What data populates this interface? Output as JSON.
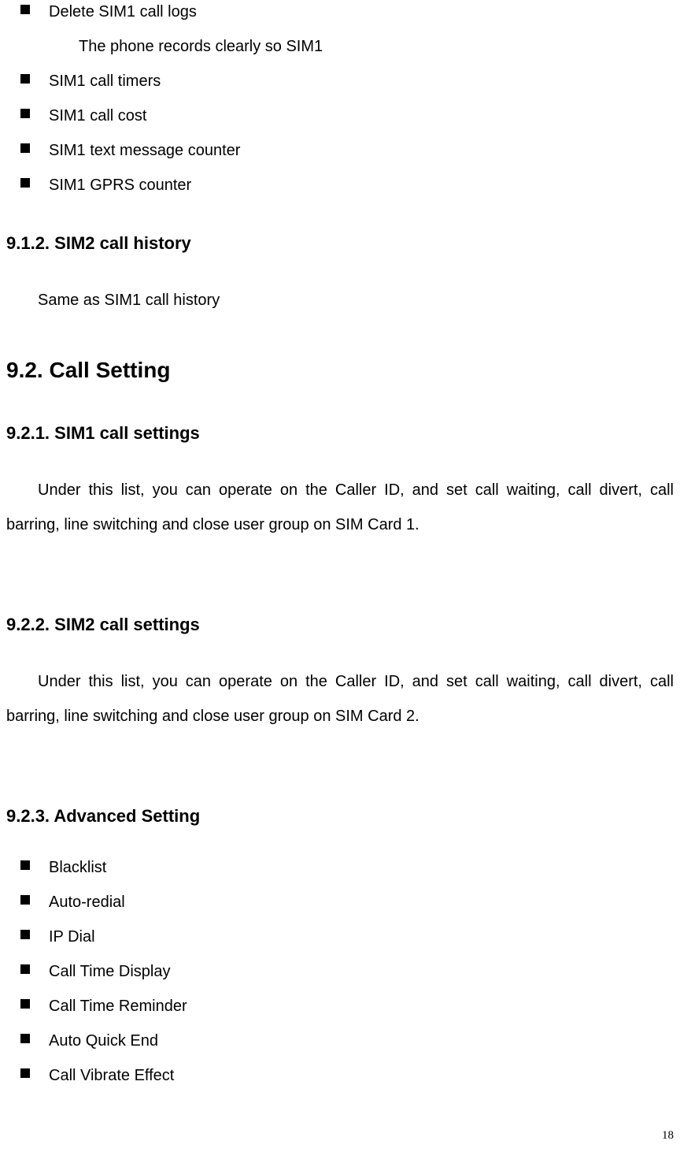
{
  "list1": {
    "items": [
      "Delete SIM1 call logs",
      "SIM1 call timers",
      "SIM1 call cost",
      "SIM1 text message counter",
      "SIM1 GPRS counter"
    ],
    "subtext": "The phone records clearly so SIM1"
  },
  "section_912": {
    "heading": "9.1.2.  SIM2 call history",
    "body": "Same as SIM1 call history"
  },
  "section_92": {
    "heading": "9.2.    Call Setting"
  },
  "section_921": {
    "heading": "9.2.1.  SIM1 call settings",
    "body": "Under this list, you can operate on the Caller ID, and set call waiting, call divert, call barring, line switching and close user group on SIM Card 1."
  },
  "section_922": {
    "heading": "9.2.2.  SIM2 call settings",
    "body": "Under this list, you can operate on the Caller ID, and set call waiting, call divert, call barring, line switching and close user group on SIM Card 2."
  },
  "section_923": {
    "heading": "9.2.3.      Advanced Setting",
    "items": [
      "Blacklist",
      "Auto-redial",
      "IP Dial",
      "Call Time Display",
      "Call Time Reminder",
      "Auto Quick End",
      "Call Vibrate Effect"
    ]
  },
  "page_number": "18"
}
